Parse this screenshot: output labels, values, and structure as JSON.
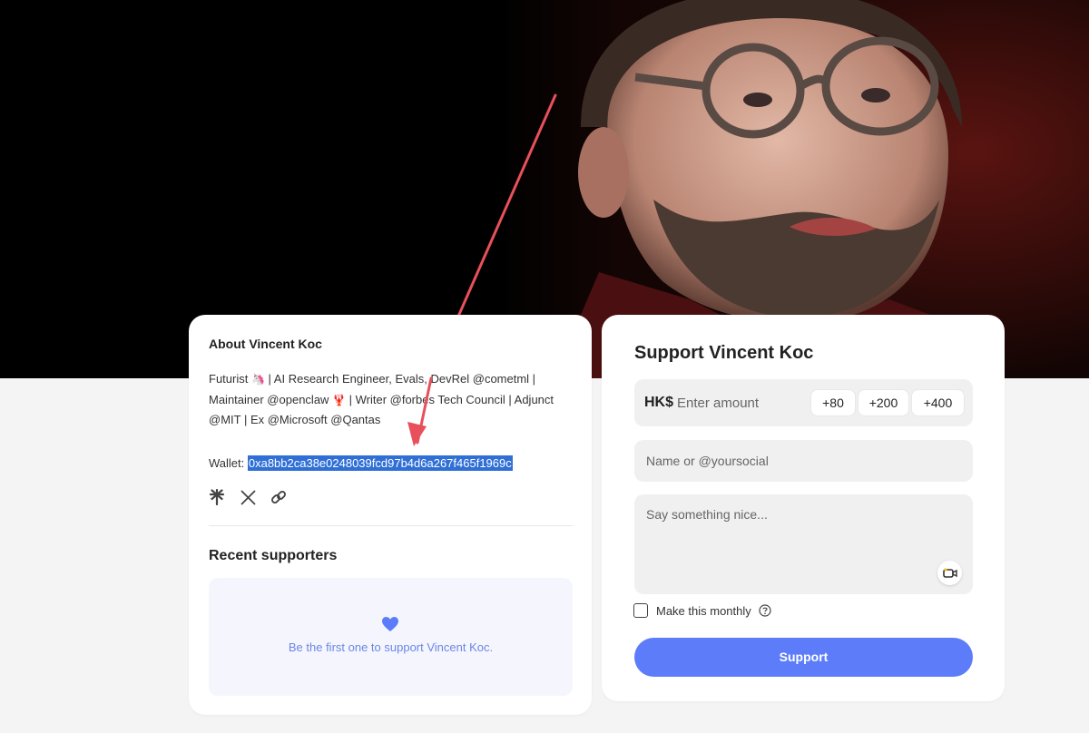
{
  "about": {
    "title": "About Vincent Koc",
    "bio_line1_a": "Futurist ",
    "bio_emoji_1": "🦄",
    "bio_line1_b": " | AI Research Engineer, Evals, DevRel @cometml |",
    "bio_line2_a": "Maintainer @openclaw ",
    "bio_emoji_2": "🦞",
    "bio_line2_b": " | Writer @forbes Tech Council | Adjunct",
    "bio_line3": "@MIT | Ex @Microsoft  @Qantas",
    "wallet_label": "Wallet: ",
    "wallet_address": "0xa8bb2ca38e0248039fcd97b4d6a267f465f1969c",
    "socials": [
      "linktree-icon",
      "x-icon",
      "link-icon"
    ],
    "recent_title": "Recent supporters",
    "empty_text": "Be the first one to support Vincent Koc."
  },
  "support": {
    "title": "Support Vincent Koc",
    "currency": "HK$",
    "amount_placeholder": "Enter amount",
    "presets": [
      "+80",
      "+200",
      "+400"
    ],
    "name_placeholder": "Name or @yoursocial",
    "message_placeholder": "Say something nice...",
    "monthly_label": "Make this monthly",
    "monthly_checked": false,
    "button_label": "Support"
  },
  "colors": {
    "accent": "#5c7cfa",
    "selection": "#2f6fd6",
    "annotation_arrow": "#e8505b"
  }
}
